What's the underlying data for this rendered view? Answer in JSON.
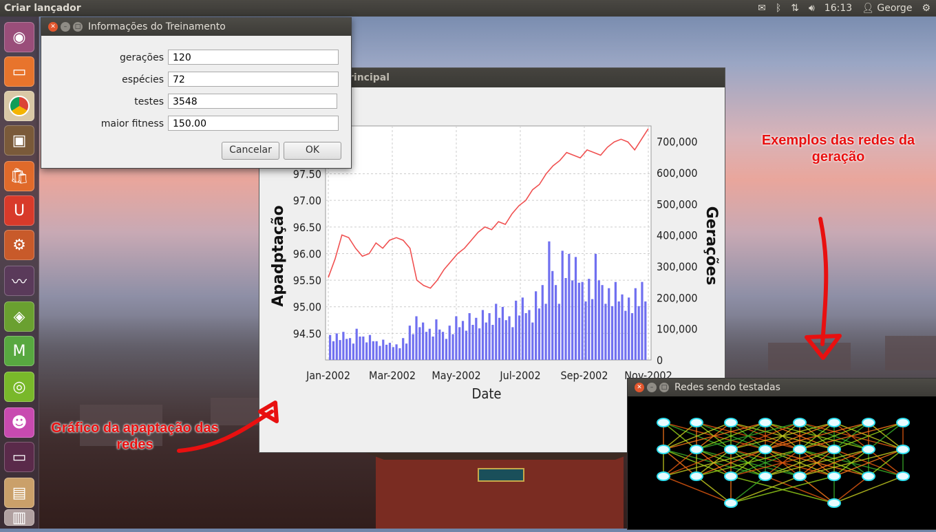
{
  "top_panel": {
    "title": "Criar lançador",
    "time": "16:13",
    "user": "George",
    "icons": [
      "mail-icon",
      "bluetooth-icon",
      "network-icon",
      "volume-icon",
      "user-icon",
      "gear-icon"
    ]
  },
  "launcher": {
    "items": [
      "ubuntu-dash-icon",
      "files-icon",
      "chrome-icon",
      "tv-icon",
      "software-center-icon",
      "ubuntu-one-icon",
      "settings-icon",
      "system-monitor-icon",
      "app-icon",
      "mendeley-icon",
      "nvidia-icon",
      "game-icon",
      "terminal-icon",
      "workspaces-icon"
    ]
  },
  "dialog": {
    "title": "Informações do Treinamento",
    "fields": [
      {
        "label": "gerações",
        "value": "120"
      },
      {
        "label": "espécies",
        "value": "72"
      },
      {
        "label": "testes",
        "value": "3548"
      },
      {
        "label": "maior fitness",
        "value": "150.00"
      }
    ],
    "cancel_label": "Cancelar",
    "ok_label": "OK"
  },
  "main_window": {
    "title": "rincipal"
  },
  "chart_data": {
    "type": "line+bar",
    "xlabel": "Date",
    "ylabel_left": "Apadptação",
    "ylabel_right": "Gerações",
    "x_ticks": [
      "Jan-2002",
      "Mar-2002",
      "May-2002",
      "Jul-2002",
      "Sep-2002",
      "Nov-2002"
    ],
    "y_left_ticks": [
      "94.50",
      "95.00",
      "95.50",
      "96.00",
      "96.50",
      "97.00",
      "97.50"
    ],
    "y_right_ticks": [
      "0",
      "100,000",
      "200,000",
      "300,000",
      "400,000",
      "500,000",
      "600,000",
      "700,000"
    ],
    "ylim_right": [
      0,
      750000
    ],
    "series": [
      {
        "kind": "line",
        "color": "#f05050",
        "values": [
          95.55,
          95.9,
          96.35,
          96.3,
          96.1,
          95.95,
          96.0,
          96.2,
          96.1,
          96.25,
          96.3,
          96.25,
          96.1,
          95.5,
          95.4,
          95.35,
          95.5,
          95.7,
          95.85,
          96.0,
          96.1,
          96.25,
          96.4,
          96.5,
          96.45,
          96.6,
          96.55,
          96.75,
          96.9,
          97.0,
          97.2,
          97.3,
          97.5,
          97.65,
          97.75,
          97.9,
          97.85,
          97.8,
          97.95,
          97.9,
          97.85,
          98.0,
          98.1,
          98.15,
          98.1,
          97.95,
          98.15,
          98.35
        ]
      },
      {
        "kind": "bar",
        "color": "#7070f0",
        "values": [
          80000,
          85000,
          90000,
          70000,
          100000,
          75000,
          80000,
          60000,
          65000,
          55000,
          50000,
          70000,
          110000,
          140000,
          120000,
          100000,
          130000,
          90000,
          110000,
          140000,
          125000,
          150000,
          135000,
          160000,
          150000,
          180000,
          170000,
          140000,
          190000,
          200000,
          160000,
          220000,
          240000,
          380000,
          240000,
          350000,
          340000,
          330000,
          250000,
          260000,
          340000,
          240000,
          230000,
          250000,
          210000,
          200000,
          230000,
          250000
        ]
      }
    ]
  },
  "net_window": {
    "title": "Redes sendo testadas"
  },
  "annotations": {
    "left": "Gráfico da apaptação das redes",
    "right": "Exemplos das redes da geração"
  }
}
